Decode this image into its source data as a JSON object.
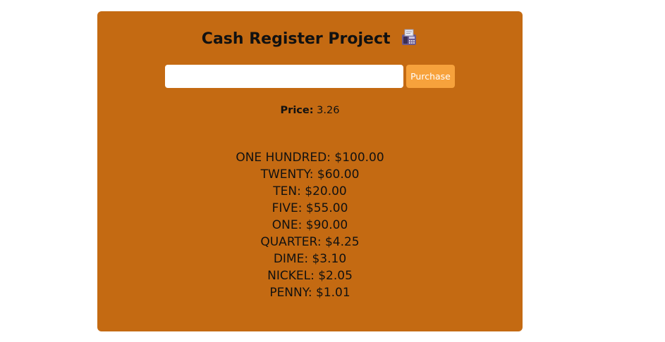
{
  "app": {
    "title": "Cash Register Project",
    "title_icon": "fax-machine-icon"
  },
  "form": {
    "input_value": "",
    "input_placeholder": "",
    "purchase_label": "Purchase"
  },
  "price": {
    "label": "Price:",
    "value": "3.26"
  },
  "drawer": [
    {
      "name": "ONE HUNDRED",
      "amount": "$100.00"
    },
    {
      "name": "TWENTY",
      "amount": "$60.00"
    },
    {
      "name": "TEN",
      "amount": "$20.00"
    },
    {
      "name": "FIVE",
      "amount": "$55.00"
    },
    {
      "name": "ONE",
      "amount": "$90.00"
    },
    {
      "name": "QUARTER",
      "amount": "$4.25"
    },
    {
      "name": "DIME",
      "amount": "$3.10"
    },
    {
      "name": "NICKEL",
      "amount": "$2.05"
    },
    {
      "name": "PENNY",
      "amount": "$1.01"
    }
  ],
  "colors": {
    "card_background": "#c46a12",
    "button_background": "#f7a23c",
    "button_text": "#ffffff"
  }
}
